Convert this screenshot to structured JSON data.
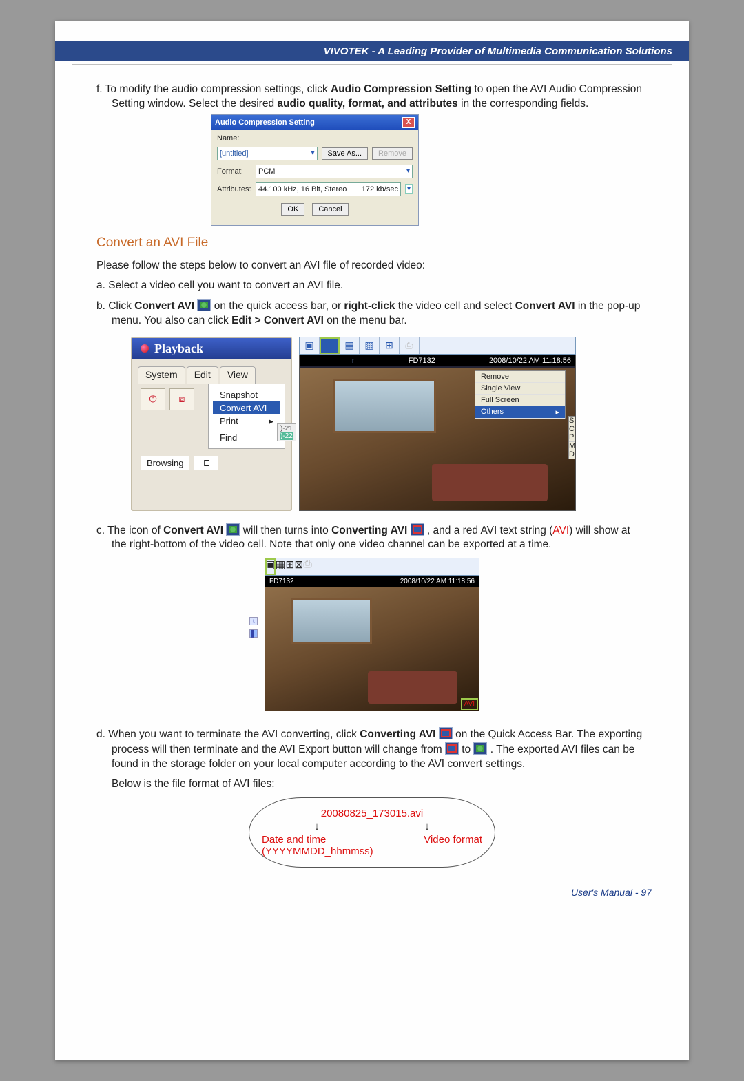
{
  "header": {
    "title": "VIVOTEK - A Leading Provider of Multimedia Communication Solutions"
  },
  "intro_f": {
    "prefix": "f. To modify the audio compression settings, click ",
    "b1": "Audio Compression Setting",
    "mid": " to open the AVI Audio Compression Setting window. Select the desired ",
    "b2": "audio quality, format, and attributes",
    "tail": " in the corresponding fields."
  },
  "acs": {
    "title": "Audio Compression Setting",
    "name_label": "Name:",
    "name_value": "[untitled]",
    "saveas": "Save As...",
    "remove": "Remove",
    "format_label": "Format:",
    "format_value": "PCM",
    "attr_label": "Attributes:",
    "attr_value": "44.100 kHz, 16 Bit, Stereo",
    "attr_rate": "172 kb/sec",
    "ok": "OK",
    "cancel": "Cancel"
  },
  "section_title": "Convert an AVI File",
  "steps": {
    "lead": "Please follow the steps below to convert an AVI file of recorded video:",
    "a": "a. Select a video cell you want to convert an AVI file.",
    "b_pre": "b. Click ",
    "b_b1": "Convert AVI",
    "b_mid1": " on the quick access bar, or ",
    "b_b2": "right-click",
    "b_mid2": " the video cell and select ",
    "b_b3": "Convert AVI",
    "b_mid3": " in the pop-up menu. You also can click ",
    "b_b4": "Edit > Convert AVI",
    "b_tail": " on the menu bar."
  },
  "playback": {
    "title": "Playback",
    "tabs": [
      "System",
      "Edit",
      "View"
    ],
    "menu": {
      "snapshot": "Snapshot",
      "convert": "Convert AVI",
      "print": "Print",
      "find": "Find"
    },
    "browsing": "Browsing",
    "e": "E"
  },
  "video1": {
    "cam": "FD7132",
    "time": "2008/10/22 AM 11:18:56",
    "col1": ")-21",
    "col2": ")-22",
    "ctx": {
      "remove": "Remove",
      "single": "Single View",
      "full": "Full Screen",
      "others": "Others"
    },
    "sub": {
      "snap": "Snapshot",
      "conv": "Convert AVI",
      "print": "Print",
      "mute": "Mute",
      "deint": "DeInterlace"
    }
  },
  "step_c": {
    "pre": "c. The icon of ",
    "b1": "Convert AVI",
    "mid1": " will then turns into ",
    "b2": "Converting AVI",
    "mid2": " , and a red AVI text string (",
    "avi": "AVI",
    "mid3": ") will show at the right-bottom of the video cell. Note that only one video channel can be exported at a time."
  },
  "video2": {
    "cam": "FD7132",
    "time": "2008/10/22 AM 11:18:56",
    "avi": "AVI"
  },
  "step_d": {
    "pre": "d. When you want to terminate the AVI converting, click ",
    "b1": "Converting AVI",
    "mid1": " on the Quick Access Bar. The exporting process will then terminate and the AVI Export button will change from ",
    "mid2": " to ",
    "mid3": ". The exported AVI files can be found in the storage folder on your local computer according to the AVI convert settings.",
    "below": "Below is the file format of AVI files:"
  },
  "fname": {
    "file": "20080825_173015",
    "ext": ".avi",
    "date": "Date and time",
    "datefmt": "(YYYYMMDD_hhmmss)",
    "vfmt": "Video format"
  },
  "footer": {
    "text": "User's Manual - 97"
  }
}
